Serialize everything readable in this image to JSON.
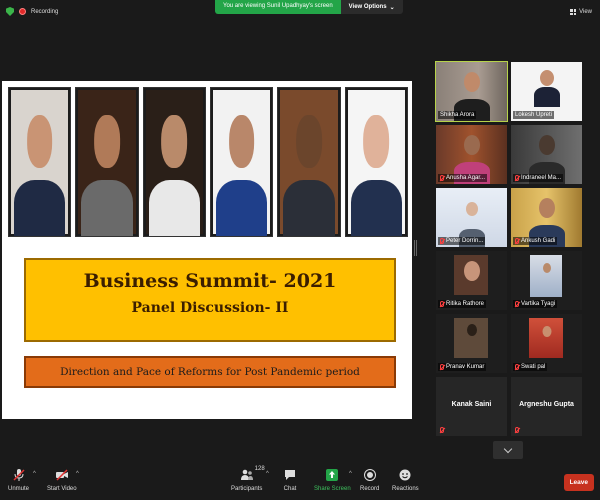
{
  "top": {
    "recording_label": "Recording",
    "viewing_text": "You are viewing Sunil Upadhyay's screen",
    "view_options_label": "View Options",
    "view_label": "View"
  },
  "slide": {
    "title": "Business Summit- 2021",
    "subtitle": "Panel Discussion- II",
    "topic": "Direction and Pace of Reforms for Post Pandemic period"
  },
  "participants": [
    {
      "name": "Shikha Arora",
      "muted": false
    },
    {
      "name": "Lokesh Upreti",
      "muted": false
    },
    {
      "name": "Anusha Agar...",
      "muted": true
    },
    {
      "name": "Indraneel Ma...",
      "muted": true
    },
    {
      "name": "Peter Dorrin...",
      "muted": true
    },
    {
      "name": "Ankush Gadi",
      "muted": true
    },
    {
      "name": "Ritika Rathore",
      "muted": true
    },
    {
      "name": "Vartika Tyagi",
      "muted": true
    },
    {
      "name": "Pranav Kumar",
      "muted": true
    },
    {
      "name": "Swati pal",
      "muted": true
    },
    {
      "name": "Kanak Saini",
      "muted": true
    },
    {
      "name": "Argneshu Gupta",
      "muted": true
    }
  ],
  "toolbar": {
    "unmute": "Unmute",
    "start_video": "Start Video",
    "participants": "Participants",
    "participant_count": "128",
    "chat": "Chat",
    "share_screen": "Share Screen",
    "record": "Record",
    "reactions": "Reactions",
    "leave": "Leave"
  },
  "colors": {
    "title_box": "#ffc000",
    "topic_box": "#e36c1a",
    "viewing_banner": "#23a548",
    "leave_button": "#c7321f",
    "active_speaker_outline": "#b7d34a"
  }
}
